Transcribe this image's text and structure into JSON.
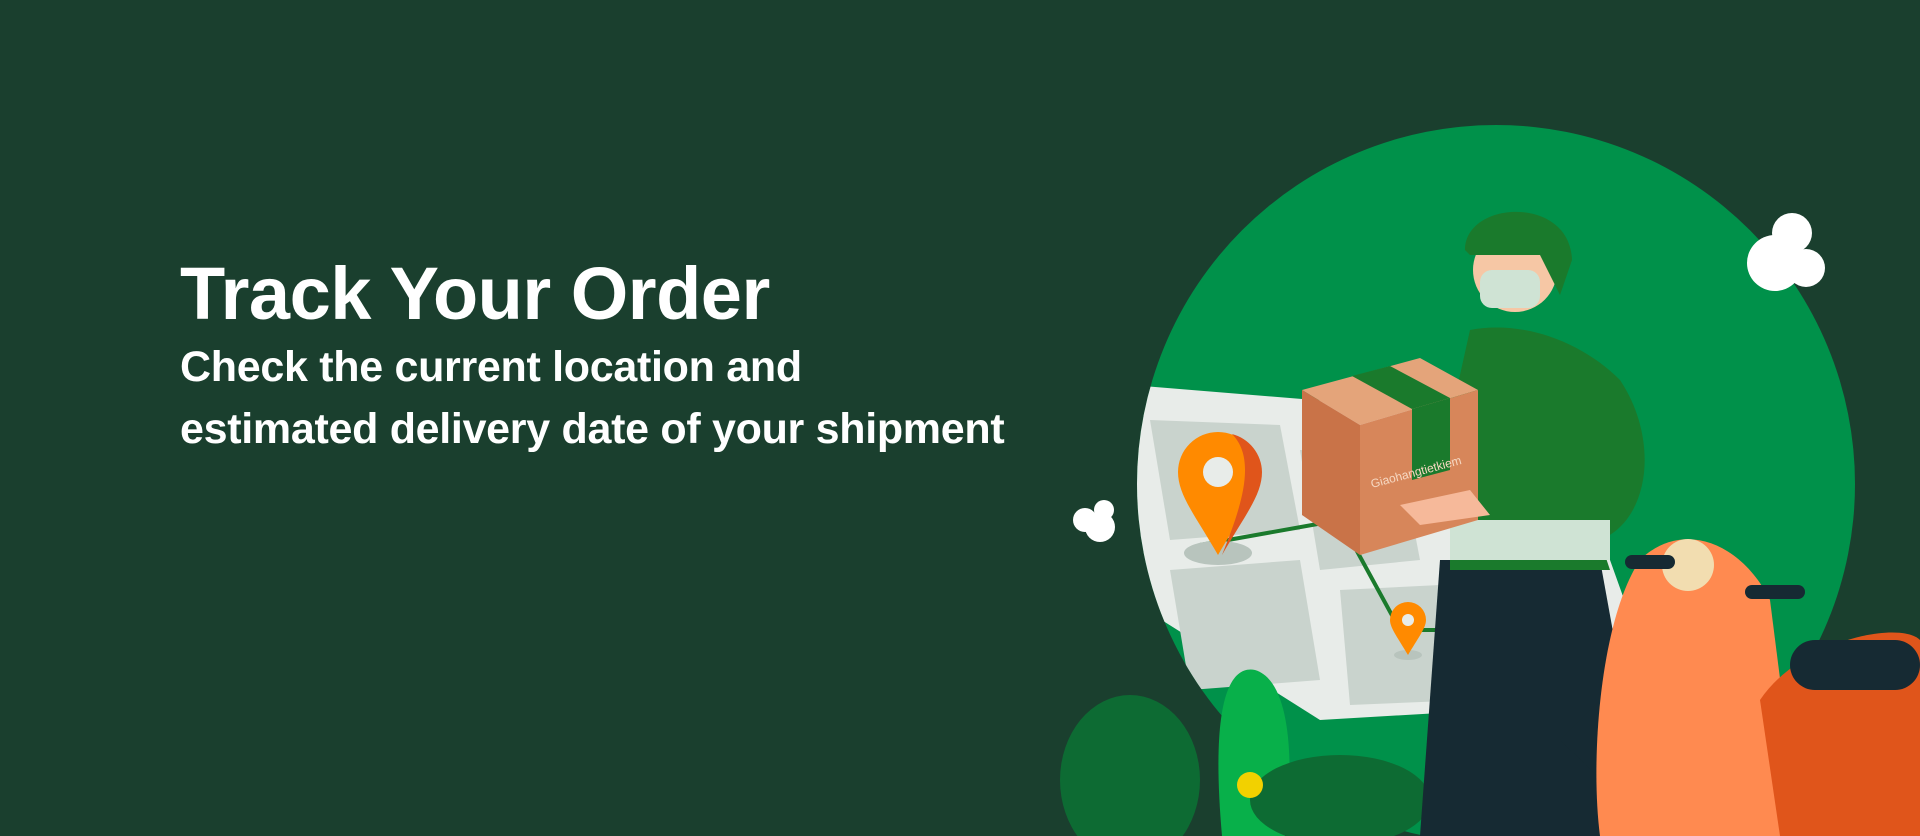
{
  "hero": {
    "title": "Track Your Order",
    "subtitle_line1": "Check the current location and",
    "subtitle_line2": "estimated delivery date of your shipment"
  },
  "illustration": {
    "box_brand": "Giaohangtietkiem",
    "icons": [
      "map-pin-icon",
      "cloud-icon",
      "courier-illustration",
      "scooter-illustration"
    ]
  },
  "colors": {
    "background": "#1a3f2e",
    "circle": "#00914a",
    "pin": "#ff8a00",
    "box": "#d7865a"
  }
}
